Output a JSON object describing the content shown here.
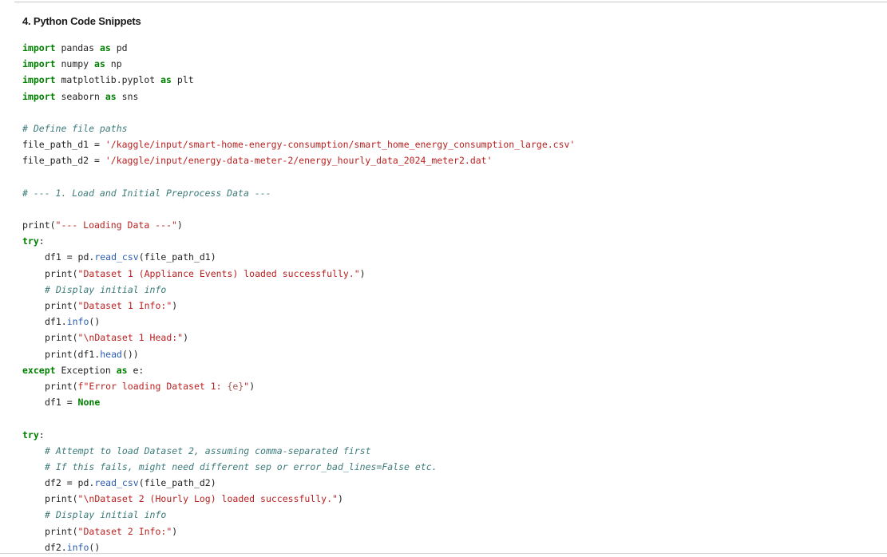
{
  "section": {
    "title": "4. Python Code Snippets"
  },
  "code": {
    "language": "python",
    "lines": [
      {
        "indent": 0,
        "tokens": [
          {
            "t": "kw",
            "v": "import"
          },
          {
            "t": "plain",
            "v": " pandas "
          },
          {
            "t": "kw",
            "v": "as"
          },
          {
            "t": "plain",
            "v": " pd"
          }
        ]
      },
      {
        "indent": 0,
        "tokens": [
          {
            "t": "kw",
            "v": "import"
          },
          {
            "t": "plain",
            "v": " numpy "
          },
          {
            "t": "kw",
            "v": "as"
          },
          {
            "t": "plain",
            "v": " np"
          }
        ]
      },
      {
        "indent": 0,
        "tokens": [
          {
            "t": "kw",
            "v": "import"
          },
          {
            "t": "plain",
            "v": " matplotlib.pyplot "
          },
          {
            "t": "kw",
            "v": "as"
          },
          {
            "t": "plain",
            "v": " plt"
          }
        ]
      },
      {
        "indent": 0,
        "tokens": [
          {
            "t": "kw",
            "v": "import"
          },
          {
            "t": "plain",
            "v": " seaborn "
          },
          {
            "t": "kw",
            "v": "as"
          },
          {
            "t": "plain",
            "v": " sns"
          }
        ]
      },
      {
        "indent": 0,
        "tokens": []
      },
      {
        "indent": 0,
        "tokens": [
          {
            "t": "cmt",
            "v": "# Define file paths"
          }
        ]
      },
      {
        "indent": 0,
        "tokens": [
          {
            "t": "plain",
            "v": "file_path_d1 = "
          },
          {
            "t": "str",
            "v": "'/kaggle/input/smart-home-energy-consumption/smart_home_energy_consumption_large.csv'"
          }
        ]
      },
      {
        "indent": 0,
        "tokens": [
          {
            "t": "plain",
            "v": "file_path_d2 = "
          },
          {
            "t": "str",
            "v": "'/kaggle/input/energy-data-meter-2/energy_hourly_data_2024_meter2.dat'"
          }
        ]
      },
      {
        "indent": 0,
        "tokens": []
      },
      {
        "indent": 0,
        "tokens": [
          {
            "t": "cmt",
            "v": "# --- 1. Load and Initial Preprocess Data ---"
          }
        ]
      },
      {
        "indent": 0,
        "tokens": []
      },
      {
        "indent": 0,
        "tokens": [
          {
            "t": "plain",
            "v": "print("
          },
          {
            "t": "str",
            "v": "\"--- Loading Data ---\""
          },
          {
            "t": "plain",
            "v": ")"
          }
        ]
      },
      {
        "indent": 0,
        "tokens": [
          {
            "t": "kw",
            "v": "try"
          },
          {
            "t": "plain",
            "v": ":"
          }
        ]
      },
      {
        "indent": 1,
        "tokens": [
          {
            "t": "plain",
            "v": "df1 = pd."
          },
          {
            "t": "attr",
            "v": "read_csv"
          },
          {
            "t": "plain",
            "v": "(file_path_d1)"
          }
        ]
      },
      {
        "indent": 1,
        "tokens": [
          {
            "t": "plain",
            "v": "print("
          },
          {
            "t": "str",
            "v": "\"Dataset 1 (Appliance Events) loaded successfully.\""
          },
          {
            "t": "plain",
            "v": ")"
          }
        ]
      },
      {
        "indent": 1,
        "tokens": [
          {
            "t": "cmt",
            "v": "# Display initial info"
          }
        ]
      },
      {
        "indent": 1,
        "tokens": [
          {
            "t": "plain",
            "v": "print("
          },
          {
            "t": "str",
            "v": "\"Dataset 1 Info:\""
          },
          {
            "t": "plain",
            "v": ")"
          }
        ]
      },
      {
        "indent": 1,
        "tokens": [
          {
            "t": "plain",
            "v": "df1."
          },
          {
            "t": "attr",
            "v": "info"
          },
          {
            "t": "plain",
            "v": "()"
          }
        ]
      },
      {
        "indent": 1,
        "tokens": [
          {
            "t": "plain",
            "v": "print("
          },
          {
            "t": "str",
            "v": "\"\\nDataset 1 Head:\""
          },
          {
            "t": "plain",
            "v": ")"
          }
        ]
      },
      {
        "indent": 1,
        "tokens": [
          {
            "t": "plain",
            "v": "print(df1."
          },
          {
            "t": "attr",
            "v": "head"
          },
          {
            "t": "plain",
            "v": "())"
          }
        ]
      },
      {
        "indent": 0,
        "tokens": [
          {
            "t": "kw",
            "v": "except"
          },
          {
            "t": "plain",
            "v": " Exception "
          },
          {
            "t": "kw",
            "v": "as"
          },
          {
            "t": "plain",
            "v": " e:"
          }
        ]
      },
      {
        "indent": 1,
        "tokens": [
          {
            "t": "plain",
            "v": "print("
          },
          {
            "t": "str",
            "v": "f\"Error loading Dataset 1: "
          },
          {
            "t": "fstr",
            "v": "{e}"
          },
          {
            "t": "str",
            "v": "\""
          },
          {
            "t": "plain",
            "v": ")"
          }
        ]
      },
      {
        "indent": 1,
        "tokens": [
          {
            "t": "plain",
            "v": "df1 = "
          },
          {
            "t": "kw",
            "v": "None"
          }
        ]
      },
      {
        "indent": 0,
        "tokens": []
      },
      {
        "indent": 0,
        "tokens": [
          {
            "t": "kw",
            "v": "try"
          },
          {
            "t": "plain",
            "v": ":"
          }
        ]
      },
      {
        "indent": 1,
        "tokens": [
          {
            "t": "cmt",
            "v": "# Attempt to load Dataset 2, assuming comma-separated first"
          }
        ]
      },
      {
        "indent": 1,
        "tokens": [
          {
            "t": "cmt",
            "v": "# If this fails, might need different sep or error_bad_lines=False etc."
          }
        ]
      },
      {
        "indent": 1,
        "tokens": [
          {
            "t": "plain",
            "v": "df2 = pd."
          },
          {
            "t": "attr",
            "v": "read_csv"
          },
          {
            "t": "plain",
            "v": "(file_path_d2)"
          }
        ]
      },
      {
        "indent": 1,
        "tokens": [
          {
            "t": "plain",
            "v": "print("
          },
          {
            "t": "str",
            "v": "\"\\nDataset 2 (Hourly Log) loaded successfully.\""
          },
          {
            "t": "plain",
            "v": ")"
          }
        ]
      },
      {
        "indent": 1,
        "tokens": [
          {
            "t": "cmt",
            "v": "# Display initial info"
          }
        ]
      },
      {
        "indent": 1,
        "tokens": [
          {
            "t": "plain",
            "v": "print("
          },
          {
            "t": "str",
            "v": "\"Dataset 2 Info:\""
          },
          {
            "t": "plain",
            "v": ")"
          }
        ]
      },
      {
        "indent": 1,
        "tokens": [
          {
            "t": "plain",
            "v": "df2."
          },
          {
            "t": "attr",
            "v": "info"
          },
          {
            "t": "plain",
            "v": "()"
          }
        ]
      }
    ]
  },
  "colors": {
    "keyword": "#008000",
    "string": "#ba2121",
    "comment": "#3d7b7b",
    "attribute": "#2a5db0",
    "text": "#222222",
    "background": "#ffffff"
  }
}
